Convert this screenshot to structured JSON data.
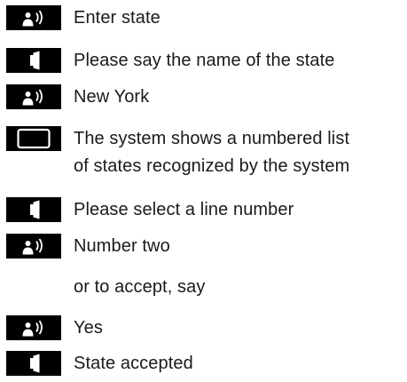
{
  "steps": [
    {
      "icon": "speaker-icon",
      "text": "Enter state"
    },
    {
      "icon": "voice-output-icon",
      "text": "Please say the name of the state"
    },
    {
      "icon": "speaker-icon",
      "text": "New York"
    },
    {
      "icon": "display-icon",
      "line1": "The system shows a numbered list",
      "line2": "of states recognized by the system"
    },
    {
      "icon": "voice-output-icon",
      "text": "Please select a line number"
    },
    {
      "icon": "speaker-icon",
      "text": "Number two"
    },
    {
      "text": "or to accept, say"
    },
    {
      "icon": "speaker-icon",
      "text": "Yes"
    },
    {
      "icon": "voice-output-icon",
      "text": "State accepted"
    }
  ]
}
